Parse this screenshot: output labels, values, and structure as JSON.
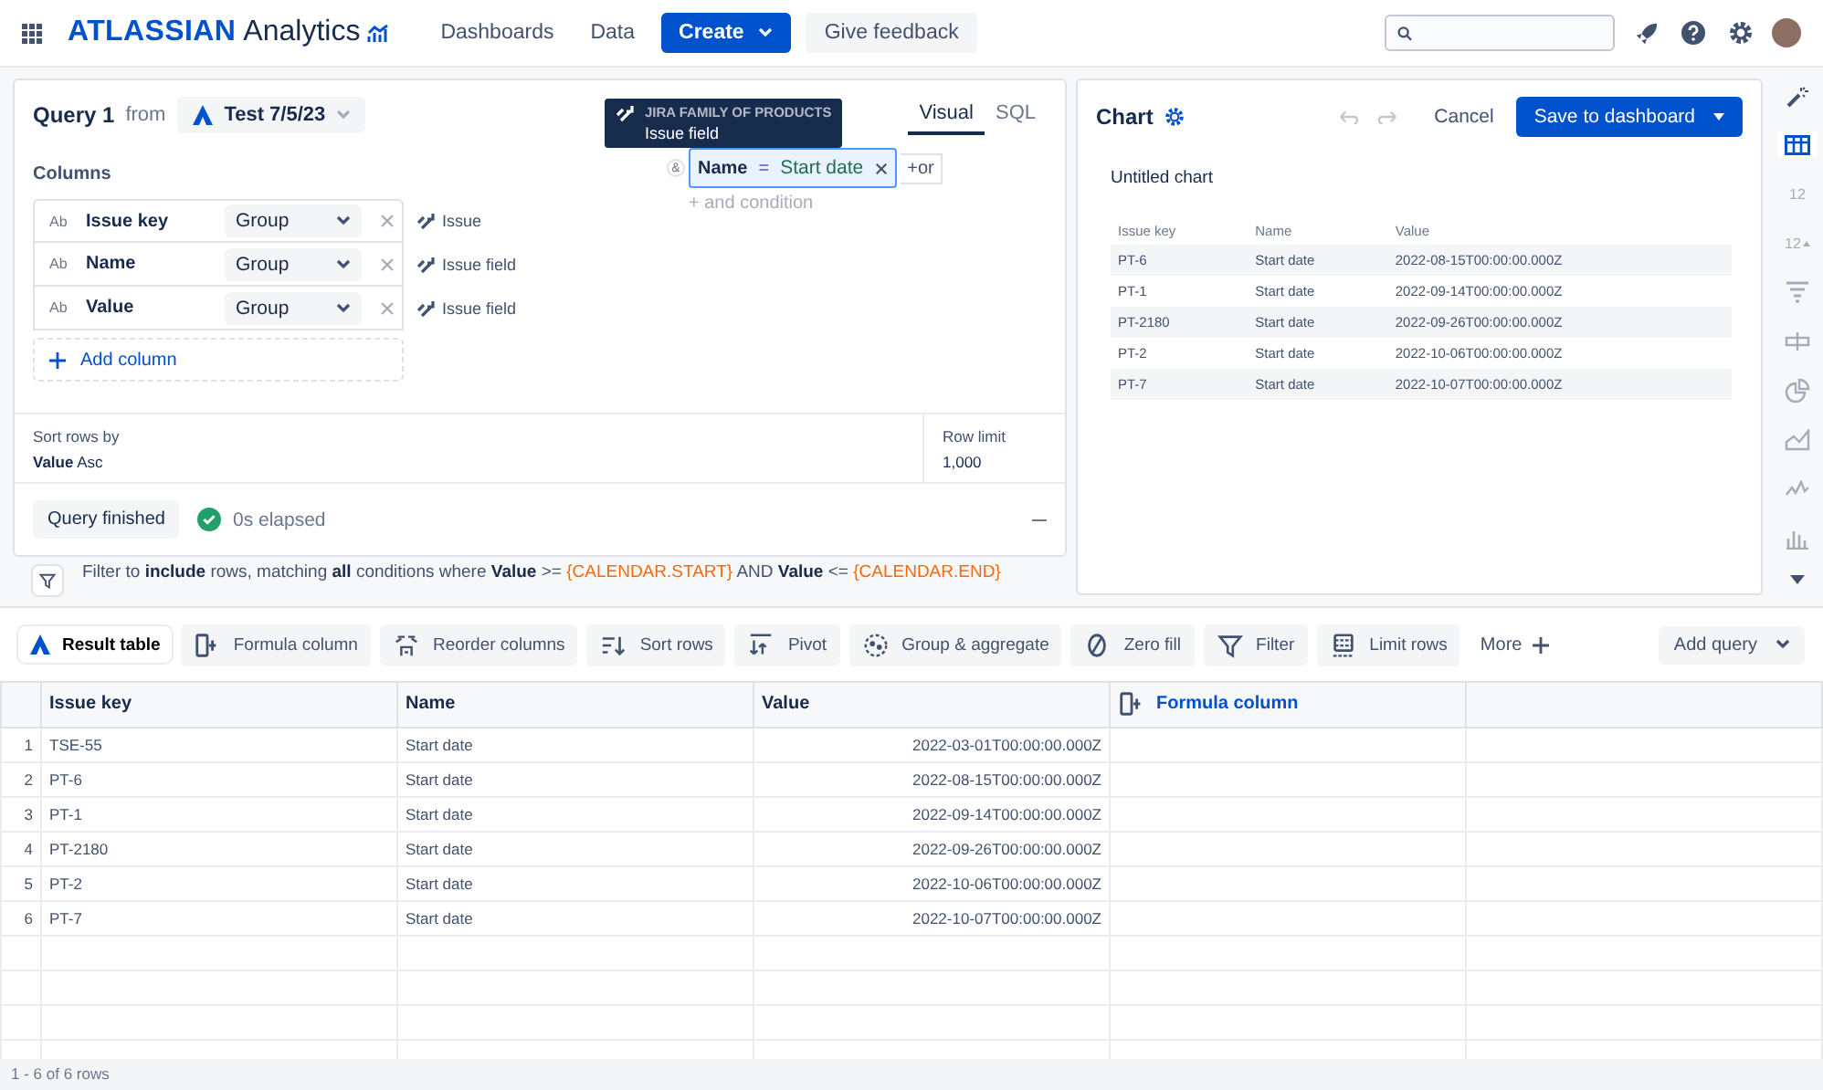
{
  "topbar": {
    "brand_bold": "ATLASSIAN",
    "brand_light": "Analytics",
    "nav": [
      {
        "label": "Dashboards"
      },
      {
        "label": "Data"
      }
    ],
    "create": "Create",
    "feedback": "Give feedback"
  },
  "query": {
    "title": "Query 1",
    "from": "from",
    "source": "Test 7/5/23",
    "tabs": [
      {
        "label": "Visual",
        "selected": true
      },
      {
        "label": "SQL",
        "selected": false
      }
    ],
    "columns_label": "Columns",
    "columns": [
      {
        "type": "Ab",
        "name": "Issue key",
        "mode": "Group",
        "source": "Issue"
      },
      {
        "type": "Ab",
        "name": "Name",
        "mode": "Group",
        "source": "Issue field"
      },
      {
        "type": "Ab",
        "name": "Value",
        "mode": "Group",
        "source": "Issue field"
      }
    ],
    "add_column": "Add column",
    "tooltip": {
      "title": "JIRA FAMILY OF PRODUCTS",
      "subtitle": "Issue field"
    },
    "condition": {
      "joiner": "&",
      "field": "Name",
      "op": "=",
      "value": "Start date",
      "or": "+or",
      "and": "+ and condition"
    },
    "sort": {
      "label": "Sort rows by",
      "field": "Value",
      "dir": "Asc"
    },
    "row_limit": {
      "label": "Row limit",
      "value": "1,000"
    },
    "status": {
      "label": "Query finished",
      "elapsed": "0s elapsed",
      "done": true
    },
    "filter": [
      {
        "kind": "text",
        "text": "Filter to **include** rows, matching **all** conditions where **Value** >= "
      },
      {
        "kind": "token",
        "text": "{CALENDAR.START}"
      },
      {
        "kind": "text",
        "text": " AND **Value** <= "
      },
      {
        "kind": "token",
        "text": "{CALENDAR.END}"
      }
    ]
  },
  "chart": {
    "title": "Chart",
    "cancel": "Cancel",
    "save": "Save to dashboard",
    "name": "Untitled chart",
    "columns": [
      "Issue key",
      "Name",
      "Value"
    ],
    "rows": [
      [
        "PT-6",
        "Start date",
        "2022-08-15T00:00:00.000Z"
      ],
      [
        "PT-1",
        "Start date",
        "2022-09-14T00:00:00.000Z"
      ],
      [
        "PT-2180",
        "Start date",
        "2022-09-26T00:00:00.000Z"
      ],
      [
        "PT-2",
        "Start date",
        "2022-10-06T00:00:00.000Z"
      ],
      [
        "PT-7",
        "Start date",
        "2022-10-07T00:00:00.000Z"
      ]
    ]
  },
  "chart_types": [
    {
      "kind": "table",
      "selected": true
    },
    {
      "kind": "number",
      "label": "12",
      "selected": false
    },
    {
      "kind": "number-trend",
      "label": "12",
      "selected": false
    },
    {
      "kind": "funnel",
      "selected": false
    },
    {
      "kind": "bar-h",
      "selected": false
    },
    {
      "kind": "pie",
      "selected": false
    },
    {
      "kind": "area",
      "selected": false
    },
    {
      "kind": "line",
      "selected": false
    },
    {
      "kind": "bar",
      "selected": false
    }
  ],
  "steps": {
    "result": "Result table",
    "items": [
      {
        "kind": "formula",
        "label": "Formula column"
      },
      {
        "kind": "reorder",
        "label": "Reorder columns"
      },
      {
        "kind": "sort",
        "label": "Sort rows"
      },
      {
        "kind": "pivot",
        "label": "Pivot"
      },
      {
        "kind": "group",
        "label": "Group & aggregate"
      },
      {
        "kind": "zero",
        "label": "Zero fill"
      },
      {
        "kind": "filter",
        "label": "Filter"
      },
      {
        "kind": "limit",
        "label": "Limit rows"
      }
    ],
    "more": "More",
    "add_query": "Add query"
  },
  "table": {
    "columns": [
      "Issue key",
      "Name",
      "Value"
    ],
    "formula": "Formula column",
    "rows": [
      {
        "n": "1",
        "cells": [
          "TSE-55",
          "Start date",
          "2022-03-01T00:00:00.000Z"
        ]
      },
      {
        "n": "2",
        "cells": [
          "PT-6",
          "Start date",
          "2022-08-15T00:00:00.000Z"
        ]
      },
      {
        "n": "3",
        "cells": [
          "PT-1",
          "Start date",
          "2022-09-14T00:00:00.000Z"
        ]
      },
      {
        "n": "4",
        "cells": [
          "PT-2180",
          "Start date",
          "2022-09-26T00:00:00.000Z"
        ]
      },
      {
        "n": "5",
        "cells": [
          "PT-2",
          "Start date",
          "2022-10-06T00:00:00.000Z"
        ]
      },
      {
        "n": "6",
        "cells": [
          "PT-7",
          "Start date",
          "2022-10-07T00:00:00.000Z"
        ]
      }
    ],
    "footer": "1 - 6 of 6 rows"
  }
}
